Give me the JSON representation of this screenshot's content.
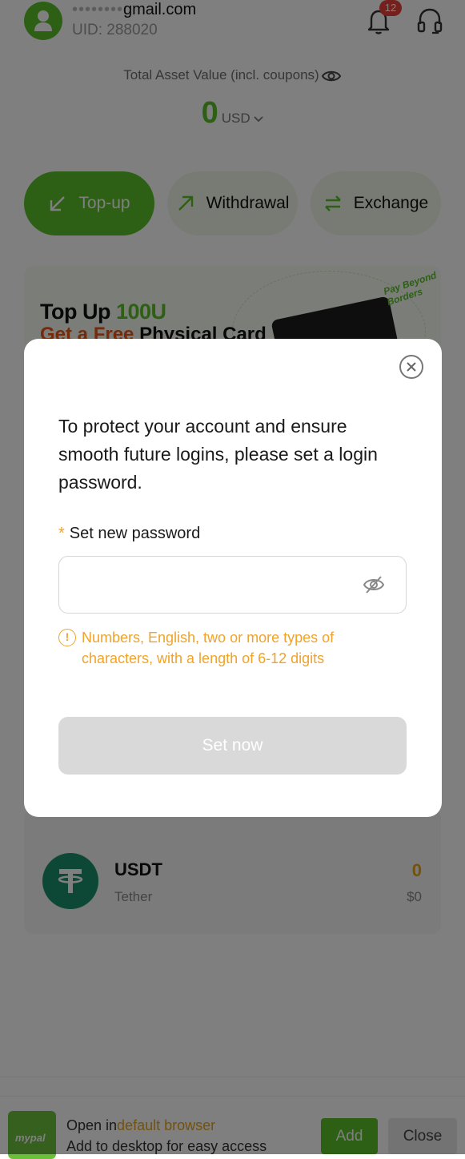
{
  "header": {
    "email_masked": "••••••••",
    "email_domain": "gmail.com",
    "uid": "UID: 288020",
    "notification_count": "12"
  },
  "balance": {
    "label": "Total Asset Value (incl. coupons)",
    "amount": "0",
    "currency": "USD"
  },
  "actions": {
    "topup": "Top-up",
    "withdrawal": "Withdrawal",
    "exchange": "Exchange"
  },
  "banner": {
    "line1_prefix": "Top Up ",
    "line1_highlight": "100U",
    "line2_prefix": "Get a Free ",
    "line2_suffix": "Physical Card",
    "slogan": "Pay Beyond Borders"
  },
  "asset": {
    "symbol": "USDT",
    "name": "Tether",
    "amount": "0",
    "usd_value": "$0"
  },
  "install_bar": {
    "line1_prefix": "Open in",
    "line1_highlight": "default browser",
    "line2": "Add to desktop for easy access",
    "logo_text": "mypal",
    "add_label": "Add",
    "close_label": "Close"
  },
  "modal": {
    "message": "To protect your account and ensure smooth future logins, please set a login password.",
    "field_required_mark": "*",
    "field_label": "Set new password",
    "password_value": "",
    "hint_icon": "!",
    "hint": "Numbers, English, two or more types of characters, with a length of 6-12 digits",
    "submit_label": "Set now"
  },
  "colors": {
    "accent": "#5bbf2a",
    "warning": "#f0a32a",
    "amount": "#e8a416",
    "badge": "#e8413a"
  }
}
